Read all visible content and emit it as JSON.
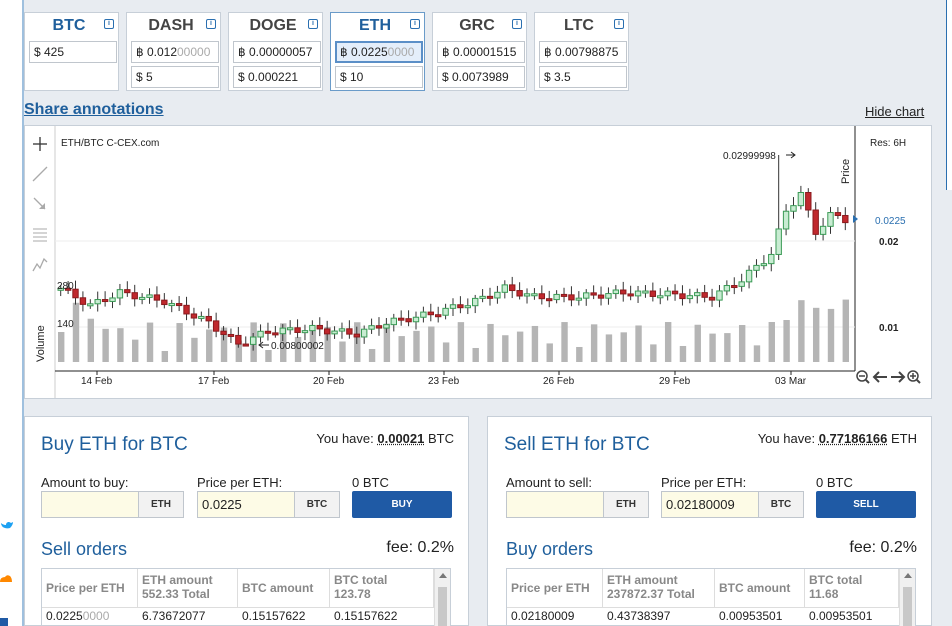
{
  "cards": [
    {
      "sym": "BTC",
      "v1a": "$ 425",
      "v1b": "",
      "v2": ""
    },
    {
      "sym": "DASH",
      "v1a": "฿ 0.012",
      "v1b": "00000",
      "v2": "$ 5"
    },
    {
      "sym": "DOGE",
      "v1a": "฿ 0.00000057",
      "v1b": "",
      "v2": "$ 0.000221"
    },
    {
      "sym": "ETH",
      "v1a": "฿ 0.0225",
      "v1b": "0000",
      "v2": "$ 10"
    },
    {
      "sym": "GRC",
      "v1a": "฿ 0.00001515",
      "v1b": "",
      "v2": "$ 0.0073989"
    },
    {
      "sym": "LTC",
      "v1a": "฿ 0.00798875",
      "v1b": "",
      "v2": "$ 3.5"
    }
  ],
  "info_icon": "i",
  "share_label": "Share annotations",
  "hide_label": "Hide chart",
  "chart": {
    "pair": "ETH/BTC C-CEX.com",
    "res": "Res: 6H",
    "price_label": "Price",
    "volume_label": "Volume",
    "current": "0.0225",
    "ticks_right": [
      "0.02",
      "0.01"
    ],
    "ticks_vol": [
      "280",
      "140"
    ],
    "high_annot": "0.02999998",
    "low_annot": "0.00800002",
    "dates": [
      "14 Feb",
      "17 Feb",
      "20 Feb",
      "23 Feb",
      "26 Feb",
      "29 Feb",
      "03 Mar"
    ]
  },
  "chart_data": {
    "type": "candlestick",
    "title": "ETH/BTC C-CEX.com",
    "ylabel": "Price",
    "y2label": "Volume",
    "x": [
      "14 Feb",
      "17 Feb",
      "20 Feb",
      "23 Feb",
      "26 Feb",
      "29 Feb",
      "03 Mar"
    ],
    "ylim": [
      0.005,
      0.033
    ],
    "high": 0.02999998,
    "low": 0.00800002,
    "last": 0.0225,
    "resolution": "6H"
  },
  "buy": {
    "title": "Buy ETH for BTC",
    "have_label": "You have:",
    "have_val": "0.00021",
    "have_cur": "BTC",
    "amount_label": "Amount to buy:",
    "amount_val": "",
    "amount_unit": "ETH",
    "price_label": "Price per ETH:",
    "price_val": "0.0225",
    "price_unit": "BTC",
    "total": "0 BTC",
    "btn": "BUY",
    "sub": "Sell orders",
    "fee": "fee: 0.2%",
    "h1": "Price per ETH",
    "h2a": "ETH amount",
    "h2b": "552.33 Total",
    "h3": "BTC amount",
    "h4a": "BTC total",
    "h4b": "123.78",
    "r1a": "0.0225",
    "r1b": "0000",
    "r2": "6.73672077",
    "r3": "0.15157622",
    "r4": "0.15157622"
  },
  "sell": {
    "title": "Sell ETH for BTC",
    "have_label": "You have:",
    "have_val": "0.77186166",
    "have_cur": "ETH",
    "amount_label": "Amount to sell:",
    "amount_val": "",
    "amount_unit": "ETH",
    "price_label": "Price per ETH:",
    "price_val": "0.02180009",
    "price_unit": "BTC",
    "total": "0 BTC",
    "btn": "SELL",
    "sub": "Buy orders",
    "fee": "fee: 0.2%",
    "h1": "Price per ETH",
    "h2a": "ETH amount",
    "h2b": "237872.37 Total",
    "h3": "BTC amount",
    "h4a": "BTC total",
    "h4b": "11.68",
    "r1": "0.02180009",
    "r2": "0.43738397",
    "r3": "0.00953501",
    "r4": "0.00953501"
  }
}
